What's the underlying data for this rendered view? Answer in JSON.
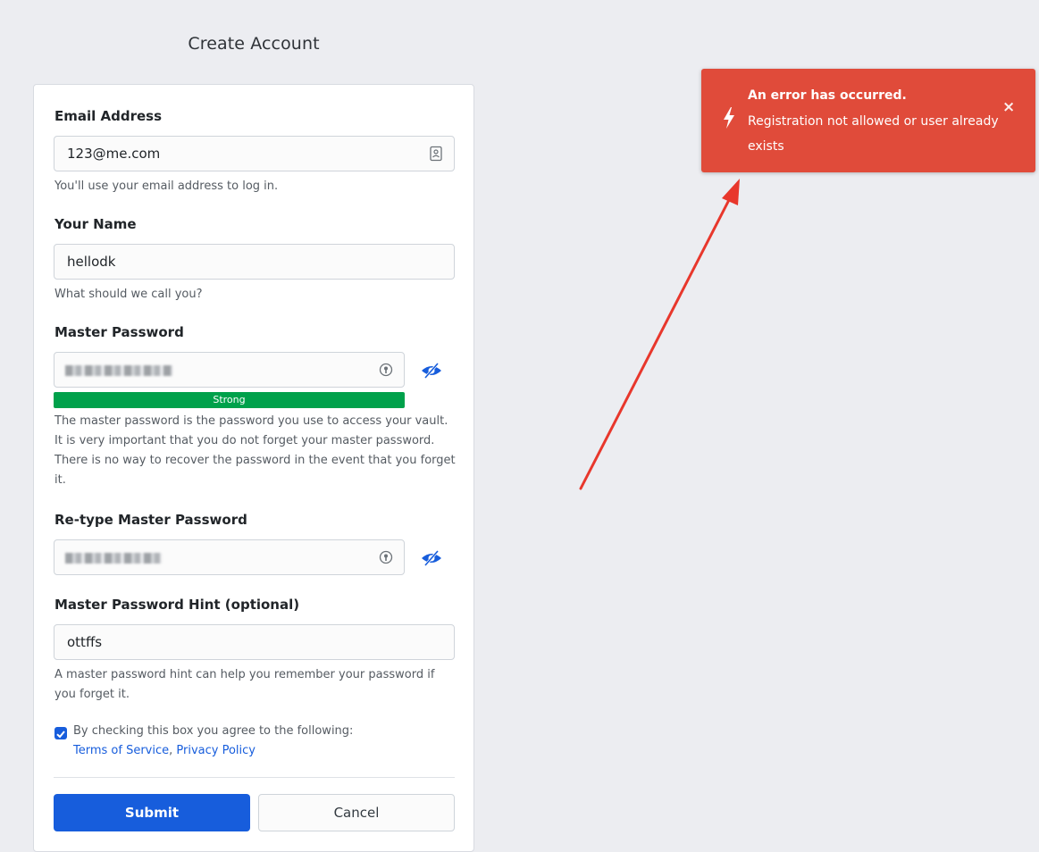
{
  "page": {
    "title": "Create Account"
  },
  "form": {
    "email": {
      "label": "Email Address",
      "value": "123@me.com",
      "help": "You'll use your email address to log in."
    },
    "name": {
      "label": "Your Name",
      "value": "hellodk",
      "help": "What should we call you?"
    },
    "master_password": {
      "label": "Master Password",
      "strength_label": "Strong",
      "strength_fraction": 1.0,
      "help": "The master password is the password you use to access your vault. It is very important that you do not forget your master password. There is no way to recover the password in the event that you forget it."
    },
    "retype_password": {
      "label": "Re-type Master Password"
    },
    "hint": {
      "label": "Master Password Hint (optional)",
      "value": "ottffs",
      "help": "A master password hint can help you remember your password if you forget it."
    },
    "agreement": {
      "checked": true,
      "text": "By checking this box you agree to the following:",
      "terms_link": "Terms of Service",
      "separator": ", ",
      "privacy_link": "Privacy Policy"
    },
    "buttons": {
      "submit": "Submit",
      "cancel": "Cancel"
    }
  },
  "toast": {
    "title": "An error has occurred.",
    "message": "Registration not allowed or user already exists",
    "close_glyph": "×",
    "icon": "bolt-icon"
  },
  "colors": {
    "primary": "#175ddc",
    "error_toast": "#e04b3a",
    "strength_strong": "#00a14b",
    "arrow": "#e8372c"
  }
}
